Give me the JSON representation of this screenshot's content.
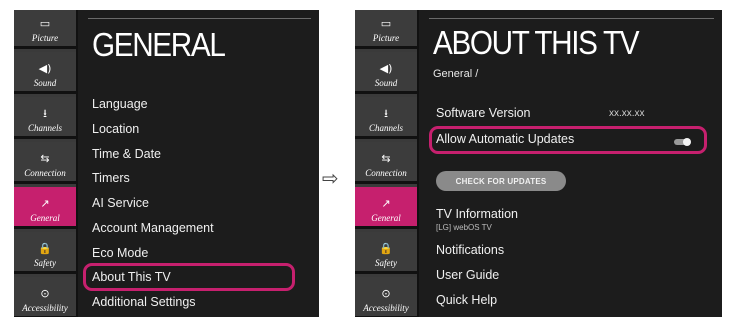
{
  "sidebar": {
    "items": [
      {
        "label": "Picture",
        "icon": "picture-icon",
        "glyph": "▭"
      },
      {
        "label": "Sound",
        "icon": "speaker-icon",
        "glyph": "◀)"
      },
      {
        "label": "Channels",
        "icon": "antenna-icon",
        "glyph": "⭳"
      },
      {
        "label": "Connection",
        "icon": "connection-icon",
        "glyph": "⇆"
      },
      {
        "label": "General",
        "icon": "wrench-icon",
        "glyph": "↗"
      },
      {
        "label": "Safety",
        "icon": "lock-icon",
        "glyph": "🔒"
      },
      {
        "label": "Accessibility",
        "icon": "accessibility-icon",
        "glyph": "⊙"
      }
    ],
    "active": "General"
  },
  "left_screen": {
    "title": "GENERAL",
    "menu": [
      "Language",
      "Location",
      "Time & Date",
      "Timers",
      "AI Service",
      "Account Management",
      "Eco Mode",
      "About This TV",
      "Additional Settings"
    ],
    "highlighted": "About This TV"
  },
  "arrow": "⇨",
  "right_screen": {
    "title": "ABOUT THIS TV",
    "breadcrumb": "General /",
    "software_version_label": "Software Version",
    "software_version_value": "xx.xx.xx",
    "auto_updates_label": "Allow Automatic Updates",
    "check_button": "CHECK FOR UPDATES",
    "tv_info_label": "TV Information",
    "tv_info_sub": "[LG] webOS TV",
    "notifications_label": "Notifications",
    "user_guide_label": "User Guide",
    "quick_help_label": "Quick Help"
  },
  "colors": {
    "accent": "#c6206e",
    "screen_bg": "#1c1c1c",
    "sidebar_bg": "#3c3c3c"
  }
}
